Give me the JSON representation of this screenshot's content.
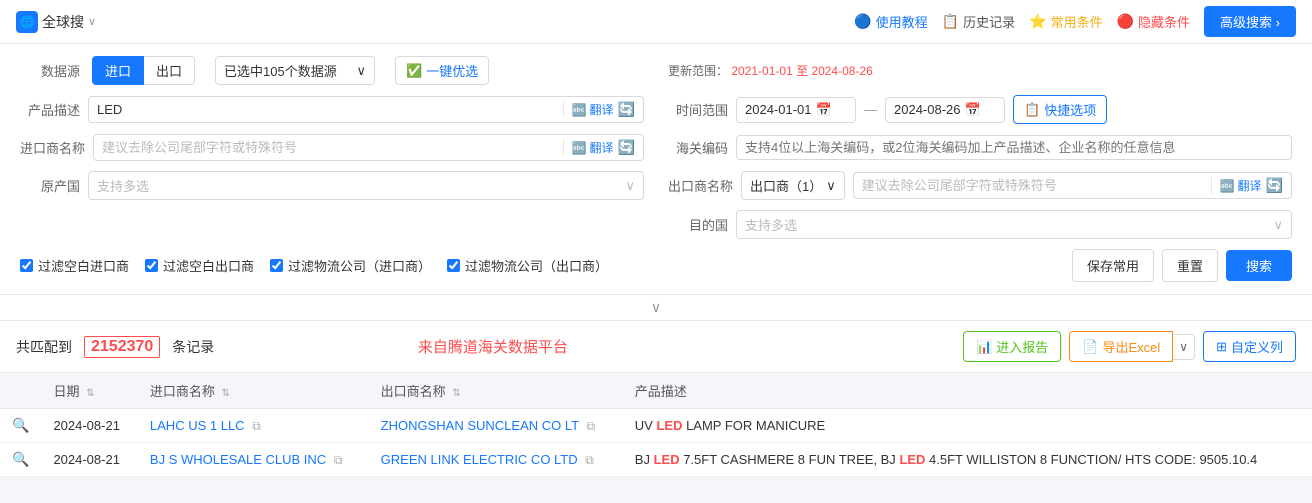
{
  "topbar": {
    "globe_label": "全球搜",
    "links": [
      {
        "id": "tutorial",
        "icon": "🔵",
        "label": "使用教程"
      },
      {
        "id": "history",
        "icon": "📋",
        "label": "历史记录"
      },
      {
        "id": "common",
        "icon": "⭐",
        "label": "常用条件"
      },
      {
        "id": "hide",
        "icon": "🔴",
        "label": "隐藏条件"
      }
    ],
    "advanced_btn": "高级搜索 ›"
  },
  "search": {
    "datasource_label": "数据源",
    "tab_import": "进口",
    "tab_export": "出口",
    "selected_sources": "已选中105个数据源",
    "one_key_btn": "一键优选",
    "update_label": "更新范围：",
    "update_range": "2021-01-01 至 2024-08-26",
    "time_range_label": "时间范围",
    "date_start": "2024-01-01",
    "date_end": "2024-08-26",
    "quick_select": "快捷选项",
    "product_label": "产品描述",
    "product_value": "LED",
    "product_placeholder": "",
    "translate_btn": "翻译",
    "hscode_label": "海关编码",
    "hscode_placeholder": "支持4位以上海关编码，或2位海关编码加上产品描述、企业名称的任意信息",
    "importer_label": "进口商名称",
    "importer_placeholder": "建议去除公司尾部字符或特殊符号",
    "exporter_label": "出口商名称",
    "exporter_select": "出口商（1）",
    "exporter_placeholder": "建议去除公司尾部字符或特殊符号",
    "origin_label": "原产国",
    "origin_placeholder": "支持多选",
    "dest_label": "目的国",
    "dest_placeholder": "支持多选",
    "checkboxes": [
      {
        "id": "filter_import",
        "label": "过滤空白进口商",
        "checked": true
      },
      {
        "id": "filter_export",
        "label": "过滤空白出口商",
        "checked": true
      },
      {
        "id": "filter_logistics_import",
        "label": "过滤物流公司（进口商）",
        "checked": true
      },
      {
        "id": "filter_logistics_export",
        "label": "过滤物流公司（出口商）",
        "checked": true
      }
    ],
    "save_btn": "保存常用",
    "reset_btn": "重置",
    "search_btn": "搜索"
  },
  "results": {
    "match_prefix": "共匹配到",
    "match_count": "2152370",
    "match_suffix": "条记录",
    "platform_text": "来自腾道海关数据平台",
    "enter_report_btn": "进入报告",
    "export_excel_btn": "导出Excel",
    "custom_col_btn": "自定义列"
  },
  "table": {
    "columns": [
      {
        "id": "date",
        "label": "日期"
      },
      {
        "id": "importer",
        "label": "进口商名称"
      },
      {
        "id": "exporter",
        "label": "出口商名称"
      },
      {
        "id": "product",
        "label": "产品描述"
      }
    ],
    "rows": [
      {
        "date": "2024-08-21",
        "importer": "LAHC US 1 LLC",
        "exporter": "ZHONGSHAN SUNCLEAN CO LT",
        "product_parts": [
          {
            "text": "UV ",
            "highlight": false
          },
          {
            "text": "LED",
            "highlight": true
          },
          {
            "text": " LAMP FOR MANICURE",
            "highlight": false
          }
        ]
      },
      {
        "date": "2024-08-21",
        "importer": "BJ S WHOLESALE CLUB INC",
        "exporter": "GREEN LINK ELECTRIC CO LTD",
        "product_parts": [
          {
            "text": "BJ ",
            "highlight": false
          },
          {
            "text": "LED",
            "highlight": true
          },
          {
            "text": " 7.5FT CASHMERE 8 FUN TREE, BJ ",
            "highlight": false
          },
          {
            "text": "LED",
            "highlight": true
          },
          {
            "text": " 4.5FT WILLISTON 8 FUNCTION/ HTS CODE: 9505.10.4",
            "highlight": false
          }
        ]
      }
    ]
  }
}
